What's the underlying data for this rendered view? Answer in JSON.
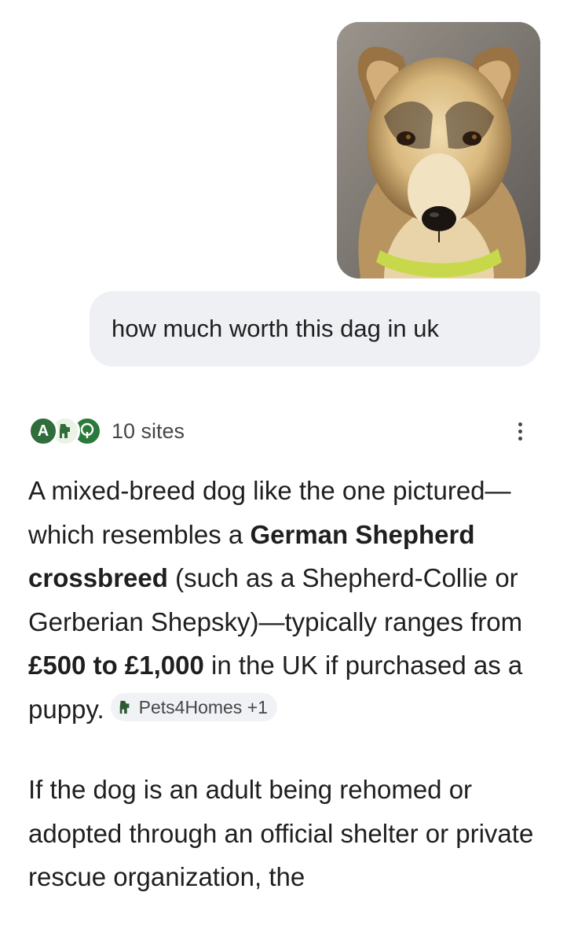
{
  "query": {
    "text": "how much worth this dag in uk"
  },
  "photo": {
    "alt_icon": "dog-photo"
  },
  "sources": {
    "count_label": "10 sites",
    "favicons": [
      "A",
      "pets4homes",
      "tree"
    ]
  },
  "answer": {
    "p1_a": "A mixed-breed dog like the one pictured—which resembles a ",
    "p1_b1": "German Shepherd crossbreed",
    "p1_c": " (such as a Shepherd-Collie or Gerberian Shepsky)—typically ranges from ",
    "p1_b2": "£500 to £1,000",
    "p1_d": " in the UK if purchased as a puppy.",
    "chip_label": "Pets4Homes +1",
    "p2": "If the dog is an adult being rehomed or adopted through an official shelter or private rescue organization, the"
  },
  "colors": {
    "bubble_bg": "#eef0f4",
    "favicon_green": "#2f6e3b",
    "text": "#1f1f1f",
    "muted": "#444746"
  }
}
